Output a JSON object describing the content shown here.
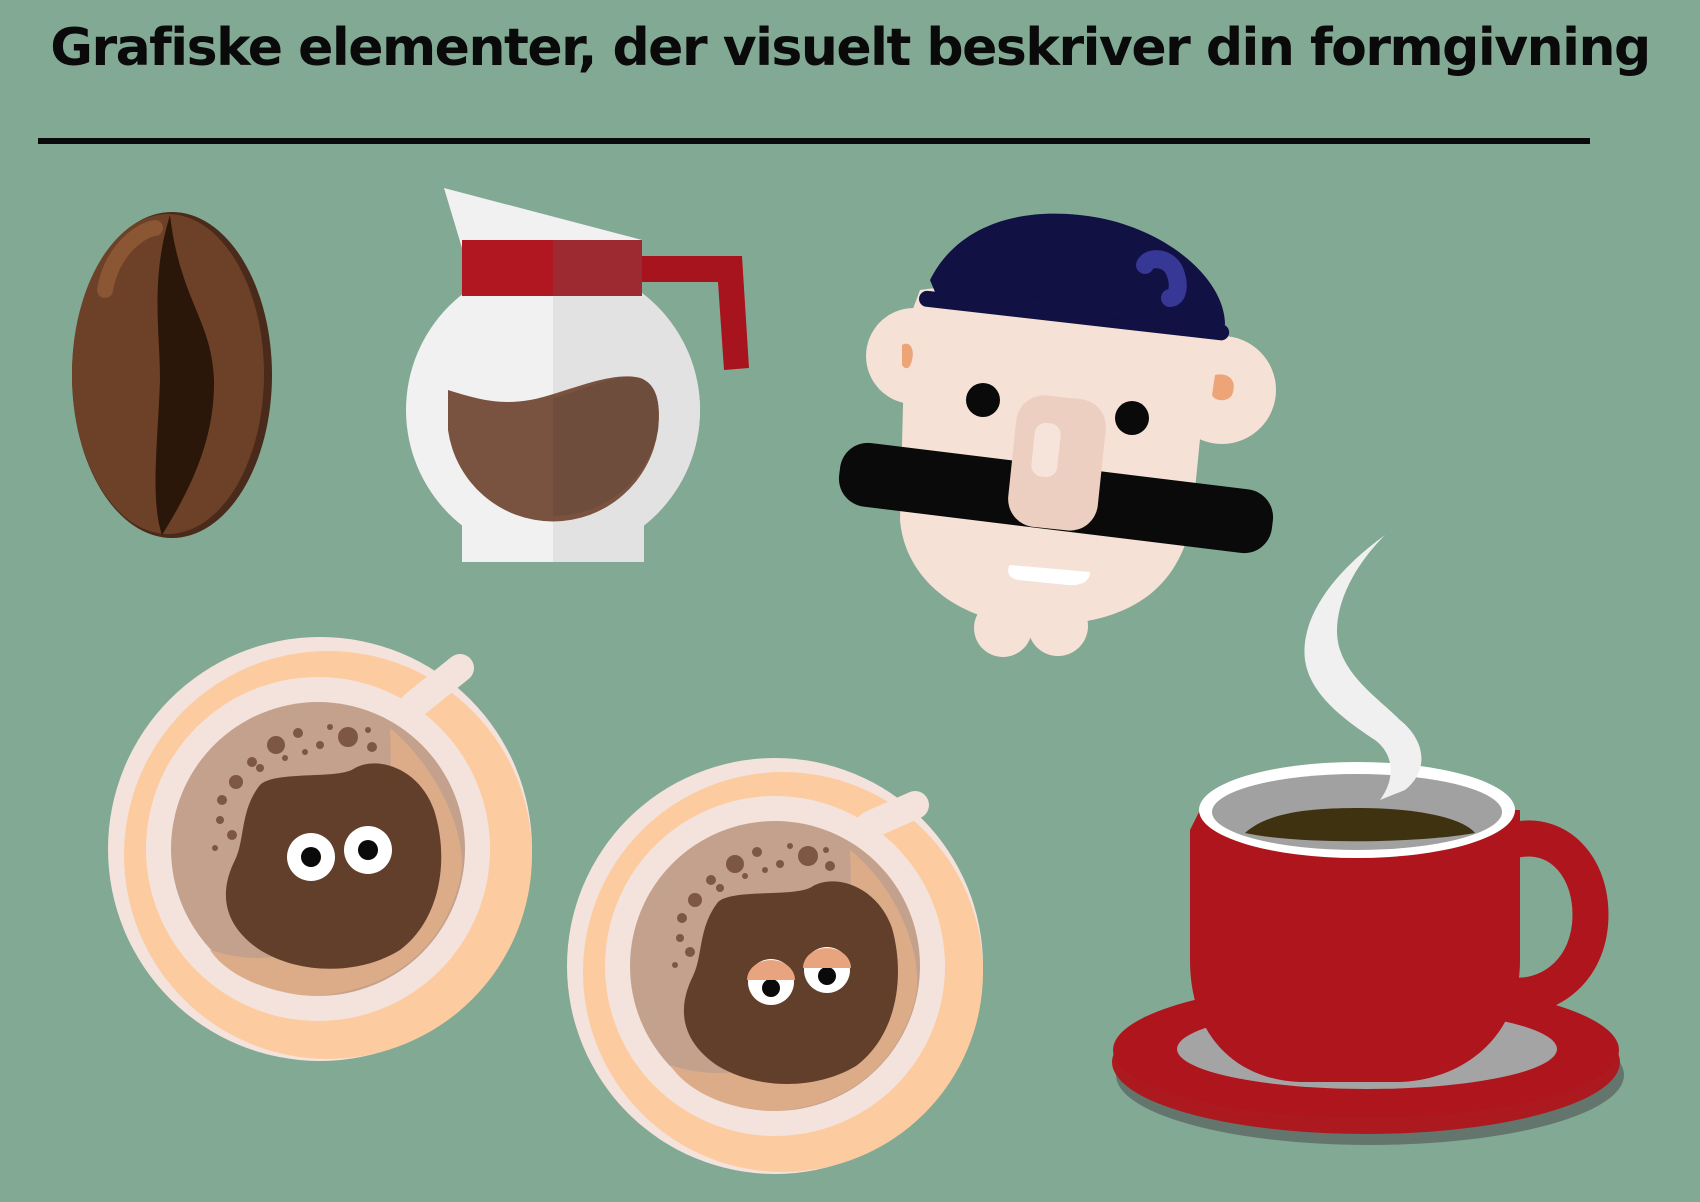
{
  "page": {
    "title": "Grafiske elementer, der visuelt beskriver din formgivning",
    "background_color": "#82a994"
  },
  "illustrations": [
    {
      "name": "coffee-bean-icon"
    },
    {
      "name": "coffee-pot-icon"
    },
    {
      "name": "mustache-man-icon"
    },
    {
      "name": "coffee-cup-awake-eyes-icon"
    },
    {
      "name": "coffee-cup-sleepy-eyes-icon"
    },
    {
      "name": "steaming-red-cup-icon"
    }
  ],
  "colors": {
    "bean_brown": "#6b3f24",
    "pot_red": "#a8141d",
    "hat_navy": "#111144",
    "cup_red": "#ae151d",
    "saucer_peach": "#fdcba0",
    "coffee_dark": "#5f3c28"
  }
}
